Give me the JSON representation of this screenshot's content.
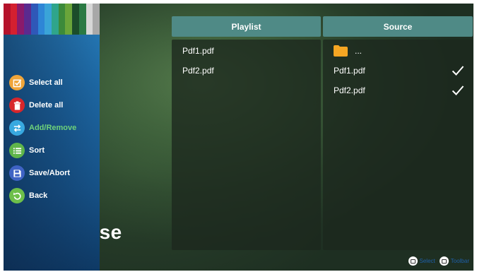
{
  "background_text": "ose",
  "sidebar": {
    "menu": [
      {
        "label": "Select all",
        "icon": "checkbox-icon",
        "color": "#f0a53a",
        "dim": false
      },
      {
        "label": "Delete all",
        "icon": "trash-icon",
        "color": "#d8262b",
        "dim": false
      },
      {
        "label": "Add/Remove",
        "icon": "swap-arrows-icon",
        "color": "#38a9e0",
        "dim": true
      },
      {
        "label": "Sort",
        "icon": "list-icon",
        "color": "#5fb54a",
        "dim": false
      },
      {
        "label": "Save/Abort",
        "icon": "floppy-disk-icon",
        "color": "#3f63c4",
        "dim": false
      },
      {
        "label": "Back",
        "icon": "back-arrow-icon",
        "color": "#6dbf4a",
        "dim": false
      }
    ]
  },
  "playlist": {
    "header": "Playlist",
    "items": [
      "Pdf1.pdf",
      "Pdf2.pdf"
    ]
  },
  "source": {
    "header": "Source",
    "parent_label": "...",
    "items": [
      {
        "name": "Pdf1.pdf",
        "checked": true
      },
      {
        "name": "Pdf2.pdf",
        "checked": true
      }
    ]
  },
  "hints": {
    "select": "Select",
    "toolbar": "Toolbar"
  },
  "colors": {
    "header_bg": "#4f8a86",
    "folder": "#f5a623",
    "hint_text": "#1e5fa8"
  }
}
